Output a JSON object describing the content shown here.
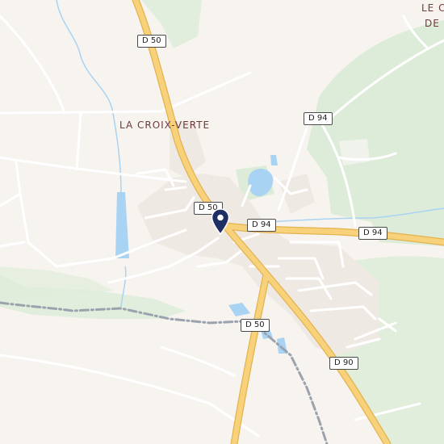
{
  "places": {
    "village": "LA CROIX-VERTE",
    "corner_line1": "LE C",
    "corner_line2": "DE"
  },
  "road_shields": {
    "d50_north": "D 50",
    "d50_center": "D 50",
    "d50_south": "D 50",
    "d94_west": "D 94",
    "d94_north": "D 94",
    "d94_east": "D 94",
    "d90": "D 90"
  },
  "colors": {
    "background": "#f7f4f0",
    "forest": "#dcecd8",
    "water": "#a9d3f2",
    "main_road": "#f3c766",
    "pin": "#1f2f63"
  },
  "marker": {
    "icon": "location-pin-icon"
  }
}
